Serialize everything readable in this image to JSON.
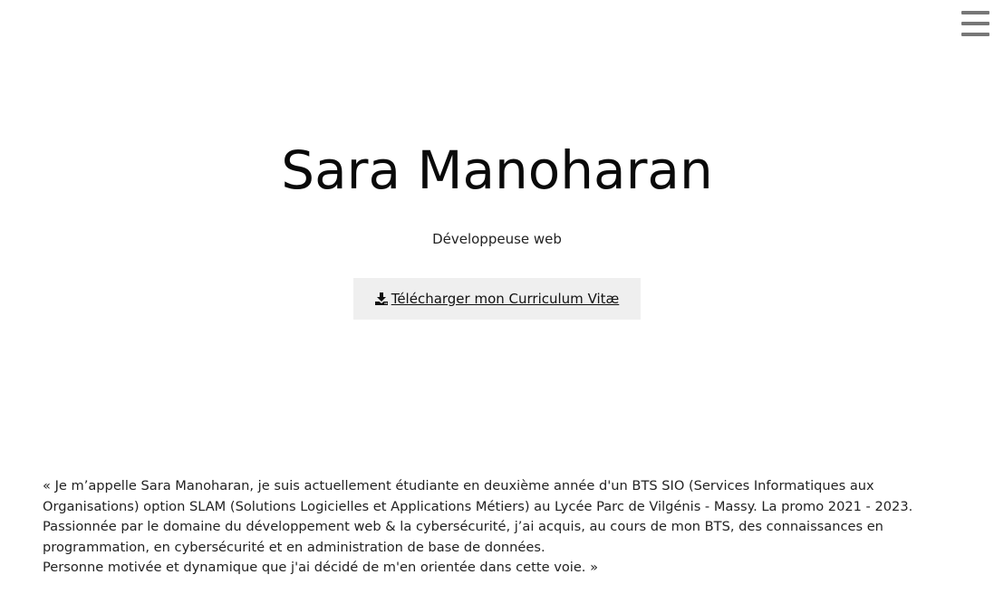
{
  "nav": {
    "menu_icon": "hamburger-menu-icon"
  },
  "hero": {
    "name": "Sara Manoharan",
    "role": "Développeuse web",
    "cv_button": {
      "icon": "download-icon",
      "label": " Télécharger mon Curriculum Vitæ"
    }
  },
  "about": {
    "line1": "« Je m’appelle Sara Manoharan, je suis actuellement étudiante en deuxième année d'un BTS SIO (Services Informatiques aux Organisations) option SLAM (Solutions Logicielles et Applications Métiers) au Lycée Parc de Vilgénis - Massy. La promo 2021 - 2023.",
    "line2": "Passionnée par le domaine du développement web & la cybersécurité, j’ai acquis, au cours de mon BTS, des connaissances en programmation, en cybersécurité et en administration de base de données.",
    "line3": "Personne motivée et dynamique que j'ai décidé de m'en orientée dans cette voie. »"
  }
}
